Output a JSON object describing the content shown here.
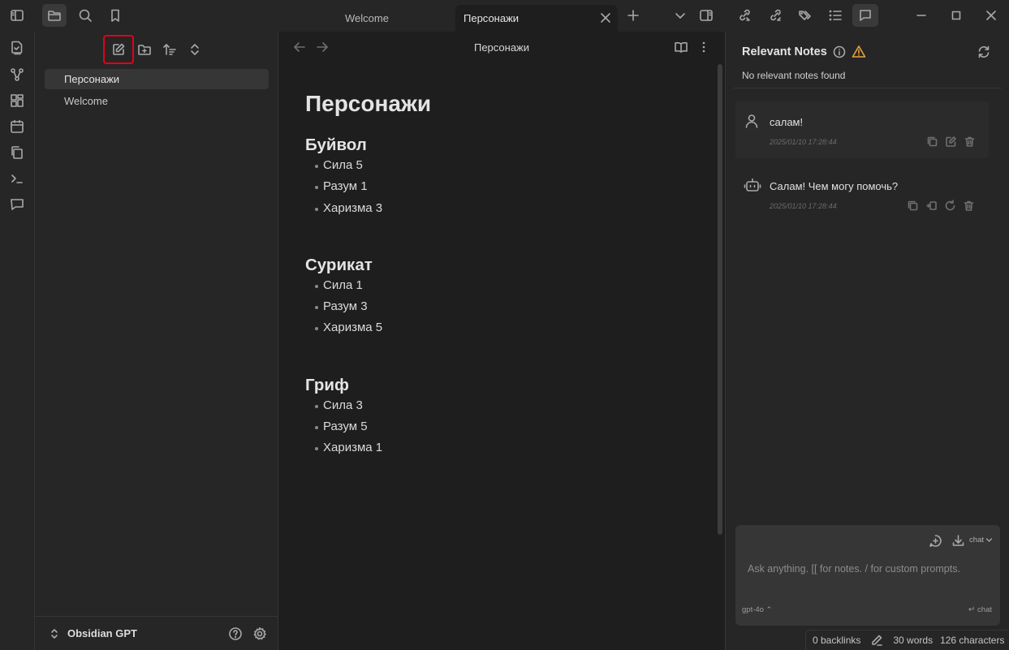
{
  "titlebar": {
    "tabs": [
      {
        "label": "Welcome",
        "active": false
      },
      {
        "label": "Персонажи",
        "active": true
      }
    ],
    "icons": [
      "sidebar-toggle-icon",
      "folder-icon",
      "search-icon",
      "bookmark-icon",
      "plus-icon",
      "chevron-down-icon",
      "right-sidebar-icon",
      "link-out-icon",
      "link-in-icon",
      "tags-icon",
      "outline-icon",
      "chat-icon",
      "minimize-icon",
      "maximize-icon",
      "close-icon"
    ]
  },
  "ribbon": {
    "icons": [
      "files-icon",
      "graph-icon",
      "canvas-icon",
      "calendar-icon",
      "copy-icon",
      "terminal-icon",
      "chat-icon"
    ]
  },
  "explorer": {
    "files": [
      {
        "label": "Персонажи",
        "selected": true
      },
      {
        "label": "Welcome",
        "selected": false
      }
    ],
    "vault_name": "Obsidian GPT"
  },
  "editor": {
    "header_title": "Персонажи",
    "title": "Персонажи",
    "sections": [
      {
        "heading": "Буйвол",
        "items": [
          "Сила 5",
          "Разум 1",
          "Харизма 3"
        ]
      },
      {
        "heading": "Сурикат",
        "items": [
          "Сила 1",
          "Разум 3",
          "Харизма 5"
        ]
      },
      {
        "heading": "Гриф",
        "items": [
          "Сила 3",
          "Разум 5",
          "Харизма 1"
        ]
      }
    ]
  },
  "right_panel": {
    "title": "Relevant Notes",
    "subtitle": "No relevant notes found",
    "messages": [
      {
        "role": "user",
        "text": "салам!",
        "time": "2025/01/10 17:28:44"
      },
      {
        "role": "assistant",
        "text": "Салам! Чем могу помочь?",
        "time": "2025/01/10 17:28:44"
      }
    ],
    "input": {
      "placeholder": "Ask anything. [[ for notes. / for custom prompts.",
      "mode": "chat",
      "model": "gpt-4o",
      "send_label": "chat"
    },
    "warning_color": "#e8a33c"
  },
  "statusbar": {
    "backlinks": "0 backlinks",
    "words": "30 words",
    "characters": "126 characters"
  },
  "colors": {
    "highlight_box": "#e3001b"
  }
}
